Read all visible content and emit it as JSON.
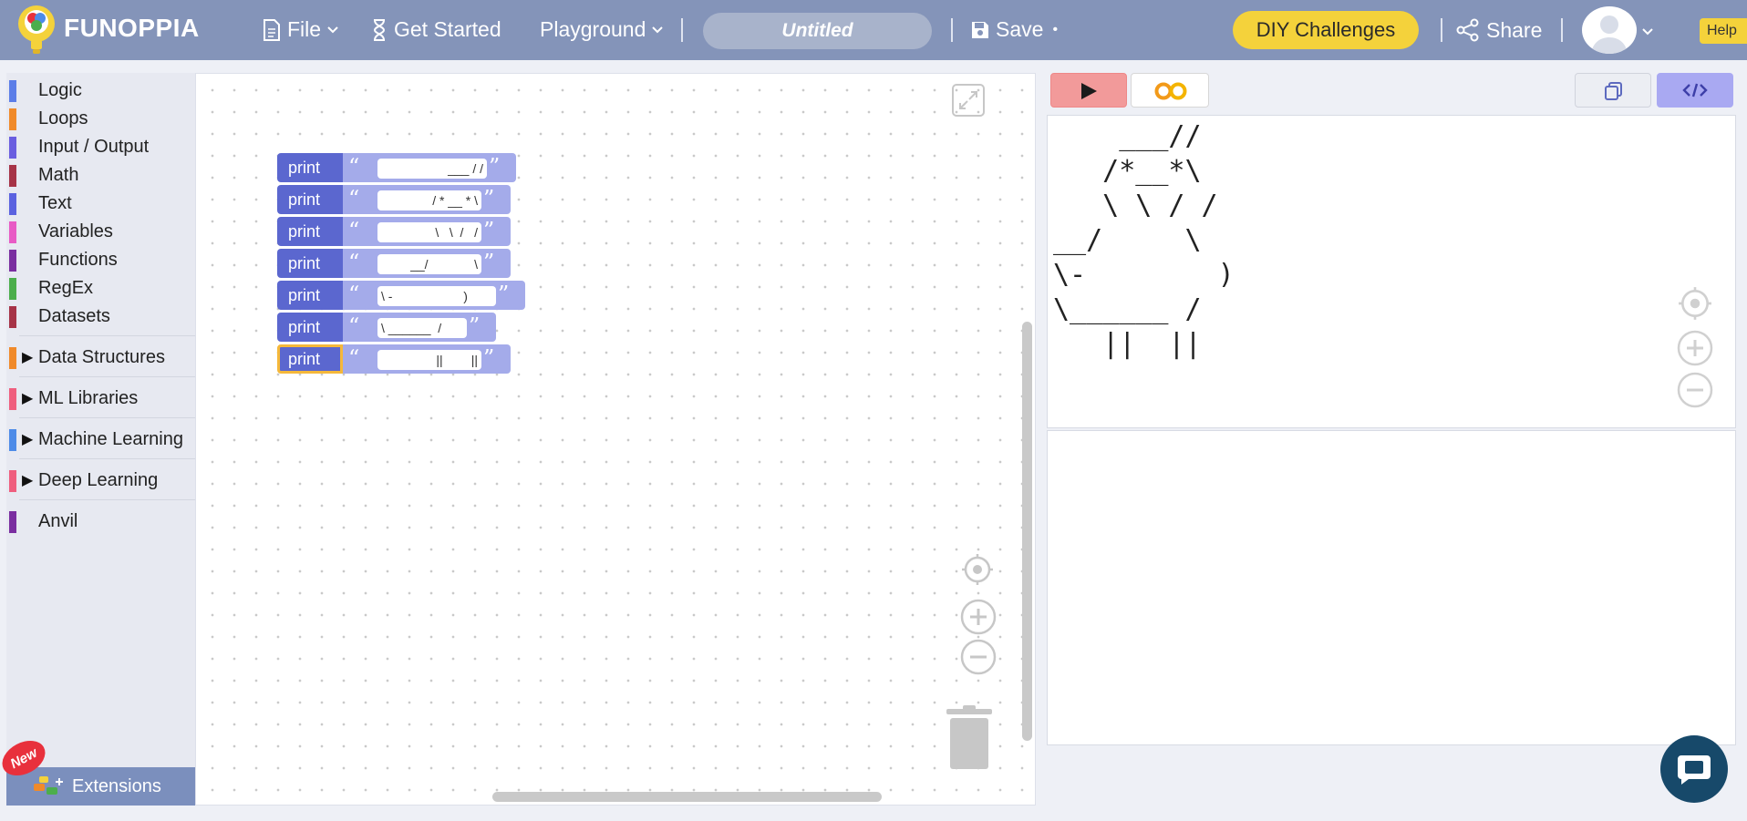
{
  "header": {
    "brand": "FUNOPPIA",
    "file_label": "File",
    "get_started_label": "Get Started",
    "playground_label": "Playground",
    "title": "Untitled",
    "save_label": "Save",
    "save_dot": "•",
    "diy_label": "DIY Challenges",
    "share_label": "Share",
    "help_label": "Help"
  },
  "sidebar": {
    "categories": [
      {
        "label": "Logic",
        "color": "#5c7ee8"
      },
      {
        "label": "Loops",
        "color": "#f08a2a"
      },
      {
        "label": "Input / Output",
        "color": "#6a5ee0"
      },
      {
        "label": "Math",
        "color": "#a63347"
      },
      {
        "label": "Text",
        "color": "#5b62e0"
      },
      {
        "label": "Variables",
        "color": "#e85bc5"
      },
      {
        "label": "Functions",
        "color": "#7a2ea0"
      },
      {
        "label": "RegEx",
        "color": "#4cae4c"
      },
      {
        "label": "Datasets",
        "color": "#a63347"
      },
      {
        "label": "Data Structures",
        "color": "#f08a2a"
      },
      {
        "label": "ML Libraries",
        "color": "#ef5e7e"
      },
      {
        "label": "Machine Learning",
        "color": "#4d8be8"
      },
      {
        "label": "Deep Learning",
        "color": "#ef5e7e"
      },
      {
        "label": "Anvil",
        "color": "#7a2ea0"
      }
    ],
    "extensions_label": "Extensions",
    "new_badge": "New"
  },
  "workspace": {
    "blocks": [
      {
        "keyword": "print",
        "text": "___ / /"
      },
      {
        "keyword": "print",
        "text": "/ * __ * \\"
      },
      {
        "keyword": "print",
        "text": "\\   \\  /   /"
      },
      {
        "keyword": "print",
        "text": "__/             \\"
      },
      {
        "keyword": "print",
        "text": "\\ -                    )"
      },
      {
        "keyword": "print",
        "text": "\\ ______  /"
      },
      {
        "keyword": "print",
        "text": "||        ||"
      }
    ]
  },
  "output": {
    "lines": "    ___//\n   /*__*\\\n   \\ \\ / /\n__/     \\\n\\-        )\n\\______ /\n   ||  ||"
  },
  "colors": {
    "header": "#8494b9",
    "accent_yellow": "#f4d23b",
    "block_keyword": "#5b67cf",
    "block_string": "#a4abea",
    "run_button": "#f29a9a",
    "code_button": "#a9a9f2"
  }
}
